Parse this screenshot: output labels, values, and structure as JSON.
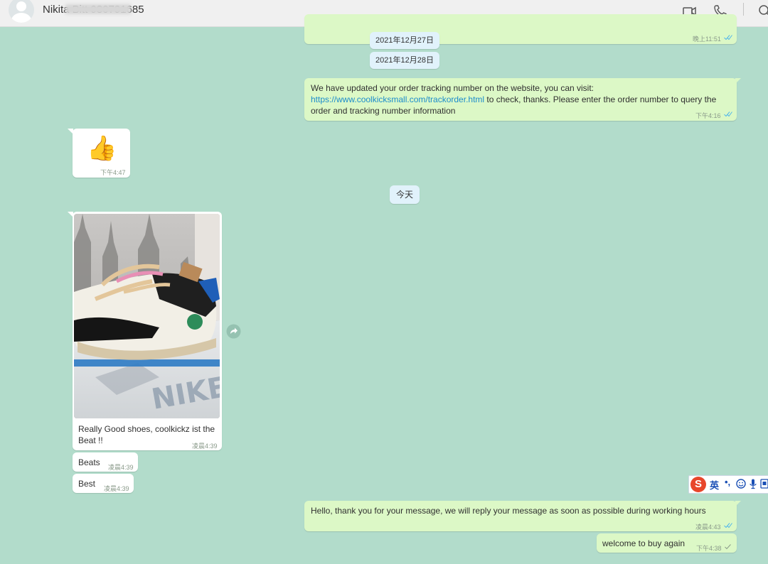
{
  "header": {
    "contact_name": "Nikita Bitt 980791685",
    "icons": [
      "video-call-icon",
      "phone-icon",
      "search-icon"
    ]
  },
  "messages": {
    "m0_time": "晚上11:51",
    "date_chip_1": "2021年12月27日",
    "date_chip_2": "2021年12月28日",
    "m1_text_a": "We have updated your order tracking number on the website, you can visit:",
    "m1_link": "https://www.coolkicksmall.com/trackorder.html",
    "m1_text_b": " to check, thanks. Please enter the order number to query the",
    "m1_text_c": "order and tracking number information",
    "m1_time": "下午4:16",
    "m2_emoji": "👍",
    "m2_time": "下午4:47",
    "today_chip": "今天",
    "m3_caption_1": "Really Good shoes, coolkickz ist the",
    "m3_caption_2": "Beat !!",
    "m3_time": "凌晨4:39",
    "m4_text": "Beats",
    "m4_time": "凌晨4:39",
    "m5_text": "Best",
    "m5_time": "凌晨4:39",
    "m6_text": "Hello, thank you for your message, we will reply your message as soon as possible during working hours",
    "m6_time": "凌晨4:43",
    "m7_text": "welcome to buy again",
    "m7_time": "下午4:38"
  },
  "ime_toolbar": {
    "logo": "S",
    "mode": "英",
    "punct": "•,"
  },
  "colors": {
    "chat_background": "#b2dccb",
    "outgoing_bubble": "#dcf8c6",
    "incoming_bubble": "#ffffff",
    "date_chip": "#e1f2fb",
    "read_tick": "#4fb6ec",
    "link": "#1c8ccc"
  }
}
